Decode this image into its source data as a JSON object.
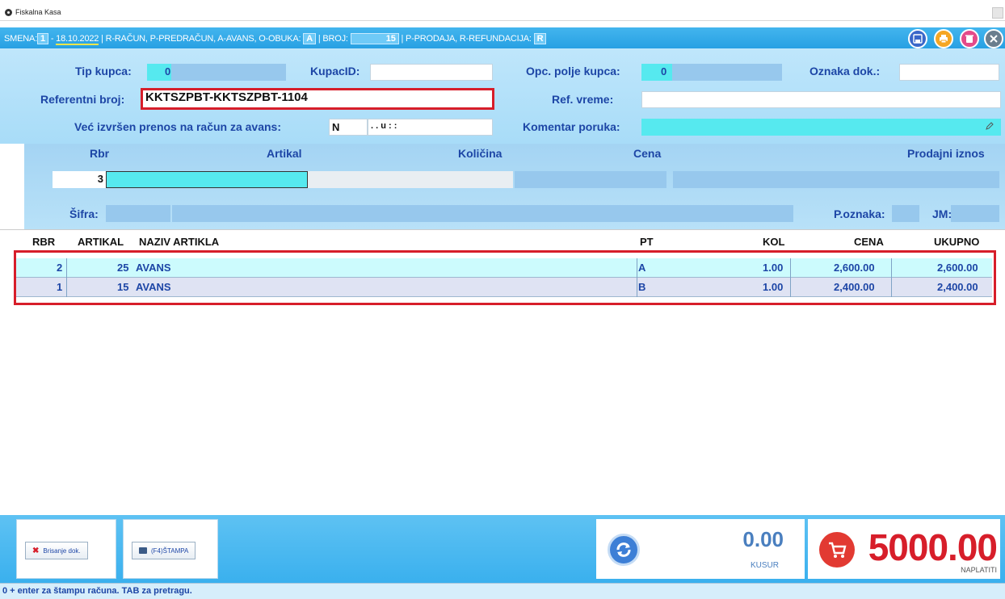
{
  "window": {
    "title": "Fiskalna Kasa"
  },
  "shift": {
    "prefix": "SMENA:",
    "number": "1",
    "date": "18.10.2022",
    "types_text": "| R-RAČUN, P-PREDRAČUN, A-AVANS, O-OBUKA:",
    "type_value": "A",
    "broj_label": "| BROJ:",
    "broj_value": "15",
    "sale_text": "| P-PRODAJA, R-REFUNDACIJA:",
    "sale_value": "R"
  },
  "form": {
    "tip_kupca_label": "Tip kupca:",
    "tip_kupca_value": "0",
    "kupac_id_label": "KupacID:",
    "kupac_id_value": "",
    "opc_polje_label": "Opc. polje kupca:",
    "opc_polje_value": "0",
    "oznaka_dok_label": "Oznaka dok.:",
    "oznaka_dok_value": "",
    "ref_broj_label": "Referentni broj:",
    "ref_broj_value": "KKTSZPBT-KKTSZPBT-1104",
    "ref_vreme_label": "Ref. vreme:",
    "ref_vreme_value": "",
    "prenos_label": "Već izvršen prenos na račun za avans:",
    "prenos_value": "N",
    "prenos_date": ". .   u  : :",
    "komentar_label": "Komentar poruka:",
    "komentar_value": ""
  },
  "entry": {
    "rbr_label": "Rbr",
    "artikal_label": "Artikal",
    "kolicina_label": "Količina",
    "cena_label": "Cena",
    "prodajni_label": "Prodajni iznos",
    "rbr_value": "3",
    "sifra_label": "Šifra:",
    "poznaka_label": "P.oznaka:",
    "jm_label": "JM:"
  },
  "table": {
    "headers": {
      "rbr": "RBR",
      "artikal": "ARTIKAL",
      "naziv": "NAZIV ARTIKLA",
      "pt": "PT",
      "kol": "KOL",
      "cena": "CENA",
      "ukupno": "UKUPNO"
    },
    "rows": [
      {
        "rbr": "2",
        "artikal": "25",
        "naziv": "AVANS",
        "pt": "A",
        "kol": "1.00",
        "cena": "2,600.00",
        "ukupno": "2,600.00"
      },
      {
        "rbr": "1",
        "artikal": "15",
        "naziv": "AVANS",
        "pt": "B",
        "kol": "1.00",
        "cena": "2,400.00",
        "ukupno": "2,400.00"
      }
    ]
  },
  "footer": {
    "brisanje_label": "Brisanje dok.",
    "stampa_label": "(F4)ŠTAMPA",
    "kusur_value": "0.00",
    "kusur_label": "KUSUR",
    "total_value": "5000.00",
    "total_label": "NAPLATITI"
  },
  "status": {
    "text": "0 + enter za štampu računa. TAB za pretragu."
  },
  "colors": {
    "accent": "#27a0e3",
    "label_blue": "#1d46a6",
    "highlight_red": "#d71e2a",
    "total_red": "#d71e2a"
  },
  "icons": [
    "save-icon",
    "print-icon",
    "delete-icon",
    "close-icon",
    "refresh-icon",
    "cart-icon",
    "pencil-icon",
    "printer-icon",
    "x-icon"
  ]
}
